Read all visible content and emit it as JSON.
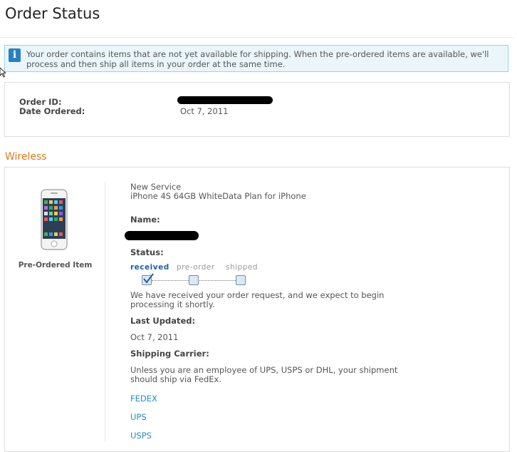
{
  "page": {
    "title": "Order Status"
  },
  "notice": {
    "text": "Your order contains items that are not yet available for shipping. When the pre-ordered items are available, we'll process and then ship all items in your order at the same time.",
    "icon": "info-icon"
  },
  "order": {
    "id_label": "Order ID:",
    "date_label": "Date Ordered:",
    "date_value": "Oct 7, 2011"
  },
  "section": {
    "title": "Wireless"
  },
  "item": {
    "badge": "Pre-Ordered Item",
    "service": "New Service",
    "product": "iPhone 4S 64GB WhiteData Plan for iPhone",
    "name_label": "Name:",
    "status_label": "Status:",
    "steps": [
      "received",
      "pre-order",
      "shipped"
    ],
    "active_step": "received",
    "status_message": "We have received your order request, and we expect to begin processing it shortly.",
    "last_updated_label": "Last Updated:",
    "last_updated_value": "Oct 7, 2011",
    "carrier_label": "Shipping Carrier:",
    "carrier_message": "Unless you are an employee of UPS, USPS or DHL, your shipment should ship via FedEx.",
    "carrier_links": [
      "FEDEX",
      "UPS",
      "USPS"
    ]
  },
  "colors": {
    "accent": "#e07a1a",
    "link": "#1d8fc4",
    "notice_bg": "#eaf6fb",
    "notice_border": "#9fd0e3"
  }
}
